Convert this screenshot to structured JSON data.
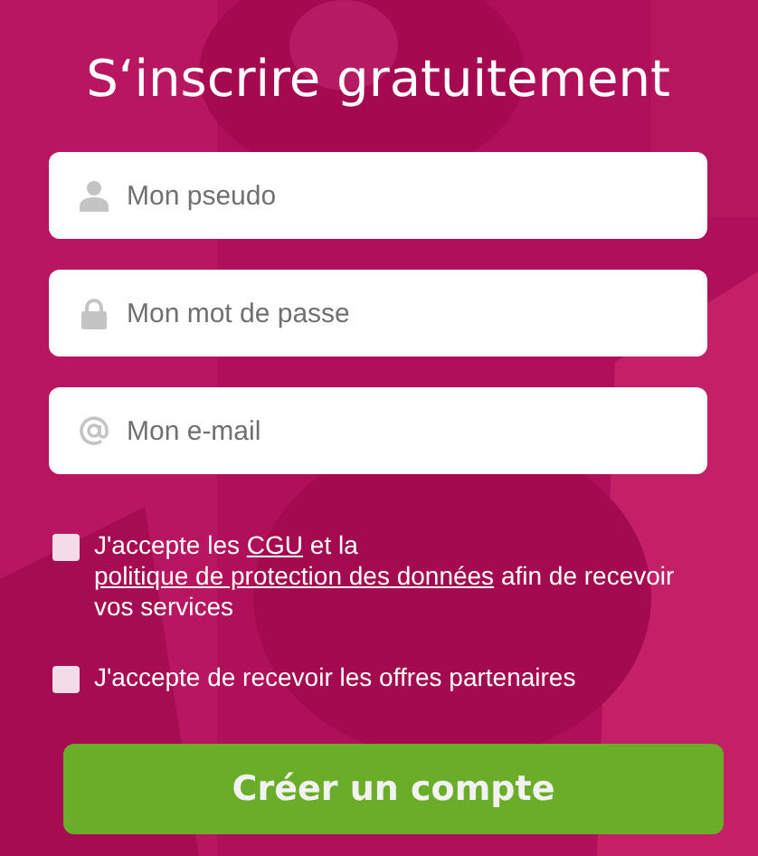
{
  "title": "S‘inscrire gratuitement",
  "fields": [
    {
      "kind": "user",
      "placeholder": "Mon pseudo"
    },
    {
      "kind": "lock",
      "placeholder": "Mon mot de passe"
    },
    {
      "kind": "email",
      "placeholder": "Mon e-mail"
    }
  ],
  "consents": [
    {
      "checked": false,
      "parts": [
        {
          "kind": "text",
          "text": "J'accepte les "
        },
        {
          "kind": "link",
          "text": "CGU"
        },
        {
          "kind": "text",
          "text": " et la "
        },
        {
          "kind": "link",
          "text": "politique de protection des données"
        },
        {
          "kind": "text",
          "text": " afin de recevoir vos services"
        }
      ]
    },
    {
      "checked": false,
      "parts": [
        {
          "kind": "text",
          "text": "J'accepte de recevoir les offres partenaires"
        }
      ]
    }
  ],
  "submit": "Créer un compte"
}
